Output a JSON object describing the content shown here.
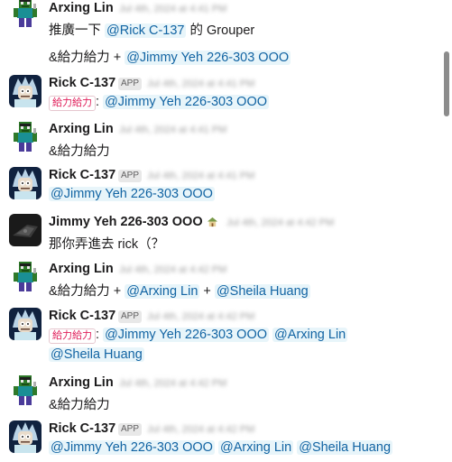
{
  "m1": {
    "name": "Arxing Lin",
    "ts": "Jul 4th, 2024 at 4:41 PM",
    "l1a": "推廣一下 ",
    "l1m": "@Rick C-137",
    "l1b": " 的 Grouper",
    "l2a": "&給力給力 + ",
    "l2m": "@Jimmy Yeh 226-303 OOO"
  },
  "m2": {
    "name": "Rick C-137",
    "app": "APP",
    "ts": "Jul 4th, 2024 at 4:41 PM",
    "tag": "給力給力",
    "colon": ": ",
    "m": "@Jimmy Yeh 226-303 OOO"
  },
  "m3": {
    "name": "Arxing Lin",
    "ts": "Jul 4th, 2024 at 4:41 PM",
    "text": "&給力給力"
  },
  "m4": {
    "name": "Rick C-137",
    "app": "APP",
    "ts": "Jul 4th, 2024 at 4:41 PM",
    "m": "@Jimmy Yeh 226-303 OOO"
  },
  "m5": {
    "name": "Jimmy Yeh 226-303 OOO",
    "ts": "Jul 4th, 2024 at 4:42 PM",
    "text": "那你弄進去 rick（？"
  },
  "m6": {
    "name": "Arxing Lin",
    "ts": "Jul 4th, 2024 at 4:42 PM",
    "a": "&給力給力 + ",
    "m1": "@Arxing Lin",
    "b": " + ",
    "m2": "@Sheila Huang"
  },
  "m7": {
    "name": "Rick C-137",
    "app": "APP",
    "ts": "Jul 4th, 2024 at 4:42 PM",
    "tag": "給力給力",
    "colon": ": ",
    "m1": "@Jimmy Yeh 226-303 OOO",
    "m2": "@Arxing Lin",
    "m3": "@Sheila Huang"
  },
  "m8": {
    "name": "Arxing Lin",
    "ts": "Jul 4th, 2024 at 4:42 PM",
    "text": "&給力給力"
  },
  "m9": {
    "name": "Rick C-137",
    "app": "APP",
    "ts": "Jul 4th, 2024 at 4:42 PM",
    "m1": "@Jimmy Yeh 226-303 OOO",
    "m2": "@Arxing Lin",
    "m3": "@Sheila Huang"
  },
  "colors": {
    "mention": "#1264a3",
    "mention_bg": "#e8f5fa",
    "tag": "#e01e5a",
    "text": "#1d1c1d"
  },
  "icons": {
    "arxing": "minecraft-character-avatar",
    "rick": "rick-avatar",
    "jimmy": "dark-avatar",
    "status": "house-emoji"
  }
}
